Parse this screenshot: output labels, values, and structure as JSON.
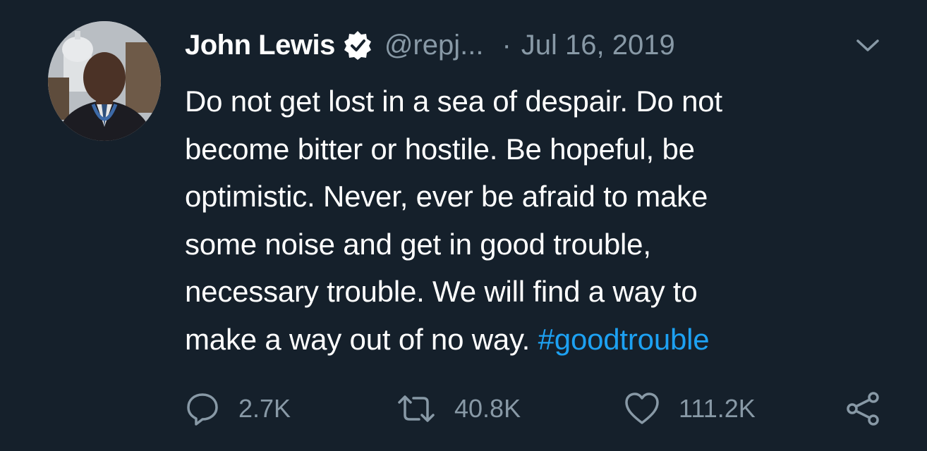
{
  "tweet": {
    "author_name": "John Lewis",
    "handle": "@repj...",
    "separator": "·",
    "date": "Jul 16, 2019",
    "text_lines": [
      "Do not get lost in a sea of despair. Do not",
      "become bitter or hostile. Be hopeful, be",
      "optimistic. Never, ever be afraid to make",
      "some noise and get in good trouble,",
      "necessary trouble. We will find a way to",
      "make a way out of no way."
    ],
    "hashtag": "#goodtrouble",
    "stats": {
      "replies": "2.7K",
      "retweets": "40.8K",
      "likes": "111.2K"
    }
  },
  "icons": {
    "verified": "verified-badge-icon",
    "menu": "chevron-down-icon",
    "reply": "reply-icon",
    "retweet": "retweet-icon",
    "like": "heart-icon",
    "share": "share-icon"
  },
  "colors": {
    "background": "#15202b",
    "text": "#ffffff",
    "secondary": "#8899a6",
    "link": "#1da1f2"
  }
}
